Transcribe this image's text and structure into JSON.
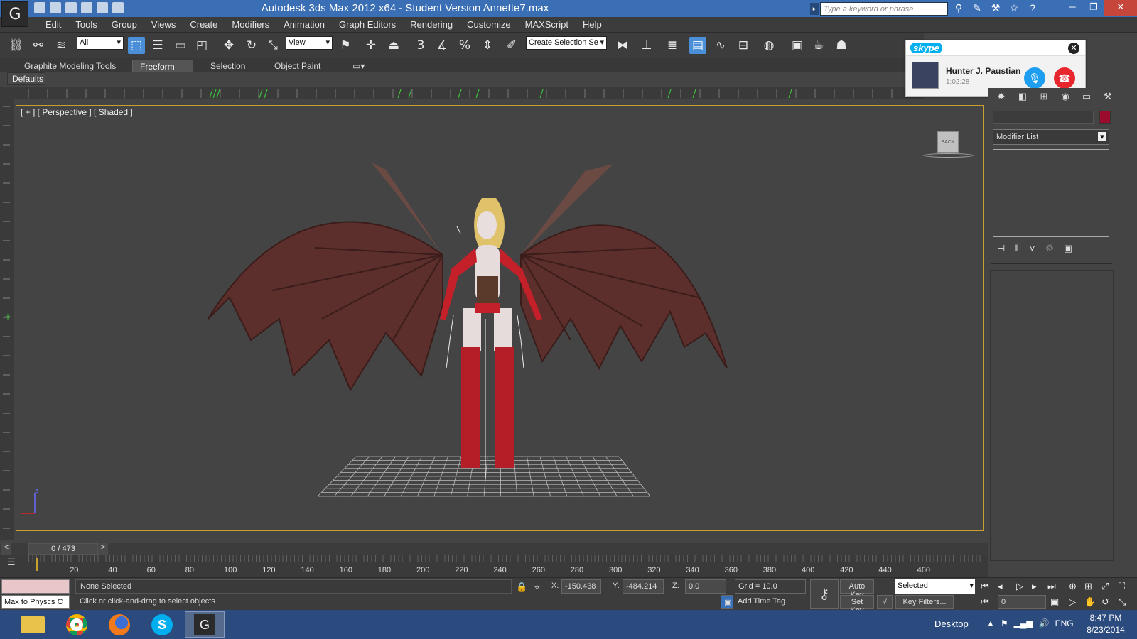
{
  "titlebar": {
    "title": "Autodesk 3ds Max  2012 x64  - Student Version   Annette7.max",
    "search_placeholder": "Type a keyword or phrase"
  },
  "menu": [
    "Edit",
    "Tools",
    "Group",
    "Views",
    "Create",
    "Modifiers",
    "Animation",
    "Graph Editors",
    "Rendering",
    "Customize",
    "MAXScript",
    "Help"
  ],
  "toolbar": {
    "filter_value": "All",
    "refcoord_value": "View",
    "selection_set_placeholder": "Create Selection Se"
  },
  "ribbon": {
    "tabs": [
      "Graphite Modeling Tools",
      "Freeform",
      "Selection",
      "Object Paint"
    ],
    "active_tab": "Freeform",
    "defaults_label": "Defaults"
  },
  "viewport": {
    "label": "[ + ] [ Perspective ] [ Shaded ]",
    "viewcube_label": "BACK"
  },
  "skype": {
    "brand": "skype",
    "caller": "Hunter J. Paustian",
    "duration": "1:02:28"
  },
  "command_panel": {
    "modifier_list": "Modifier List",
    "object_color": "#9a0b2c"
  },
  "timeline": {
    "frame_label": "0 / 473",
    "prev": "<",
    "next": ">",
    "ticks": [
      "20",
      "40",
      "60",
      "80",
      "100",
      "120",
      "140",
      "160",
      "180",
      "200",
      "220",
      "240",
      "260",
      "280",
      "300",
      "320",
      "340",
      "360",
      "380",
      "400",
      "420",
      "440",
      "460"
    ]
  },
  "status": {
    "listener_text": "Max to Physcs C",
    "selection": "None Selected",
    "prompt": "Click or click-and-drag to select objects",
    "x_label": "X:",
    "x_value": "-150.438",
    "y_label": "Y:",
    "y_value": "-484.214",
    "z_label": "Z:",
    "z_value": "0.0",
    "grid": "Grid = 10.0",
    "add_time_tag": "Add Time Tag",
    "auto_key": "Auto Key",
    "set_key": "Set Key",
    "key_mode_value": "Selected",
    "key_filters": "Key Filters...",
    "current_frame": "0"
  },
  "taskbar": {
    "desktop_label": "Desktop",
    "language": "ENG",
    "time": "8:47 PM",
    "date": "8/23/2014"
  }
}
